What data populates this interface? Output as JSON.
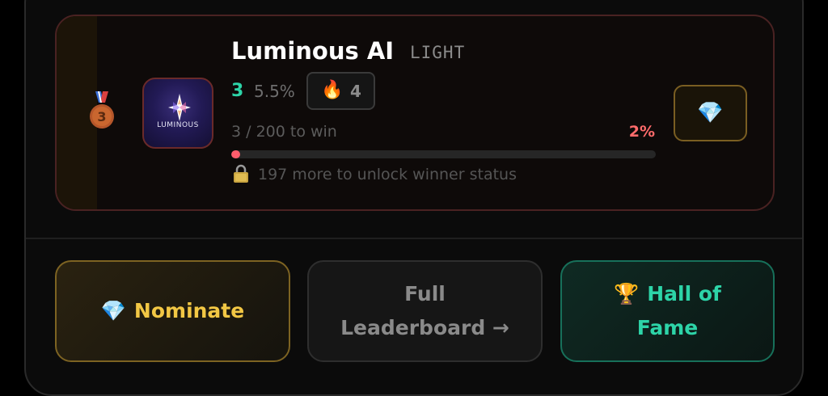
{
  "entry": {
    "name": "Luminous AI",
    "tag": "LIGHT",
    "rank": "3",
    "percent": "5.5%",
    "streak": "4",
    "logo_text": "LUMINOUS",
    "medal_rank": "3",
    "progress_text": "3 / 200 to win",
    "progress_pct": "2%",
    "progress_fraction": 0.02,
    "unlock_text": "197 more to unlock winner status"
  },
  "actions": {
    "nominate_label": "Nominate",
    "leaderboard_line1": "Full",
    "leaderboard_line2": "Leaderboard →",
    "fame_line1": "Hall of",
    "fame_line2": "Fame"
  },
  "icons": {
    "medal": "bronze-medal-icon",
    "fire": "fire-icon",
    "lock": "lock-icon",
    "gem": "gem-icon",
    "trophy": "trophy-icon"
  },
  "colors": {
    "accent_green": "#2dd4a8",
    "accent_gold": "#f2c744",
    "accent_red": "#ff6b6b"
  }
}
